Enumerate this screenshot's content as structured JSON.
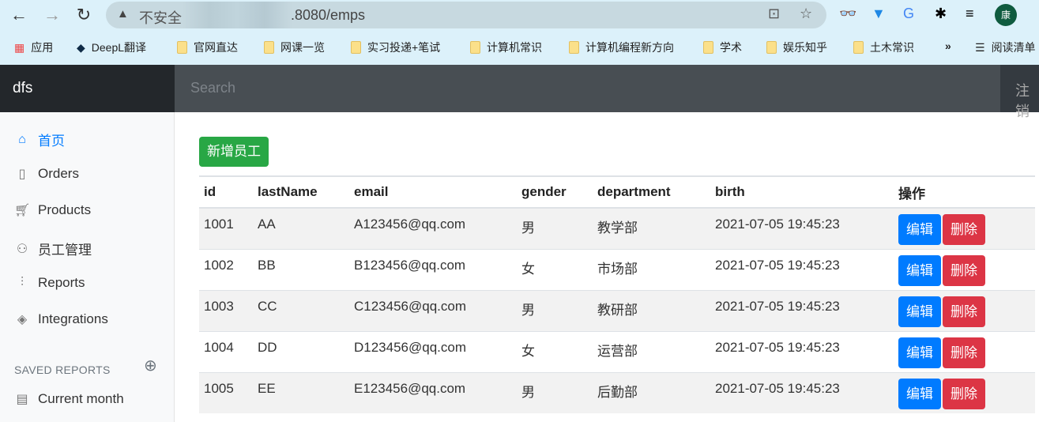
{
  "browser": {
    "security_label": "不安全",
    "url": ".8080/emps",
    "avatar_label": "康",
    "bookmarks": [
      {
        "label": "应用",
        "icon": "apps-icon"
      },
      {
        "label": "DeepL翻译",
        "icon": "deepl-icon"
      },
      {
        "label": "官网直达",
        "icon": "folder-icon"
      },
      {
        "label": "网课一览",
        "icon": "folder-icon"
      },
      {
        "label": "实习投递+笔试",
        "icon": "folder-icon"
      },
      {
        "label": "计算机常识",
        "icon": "folder-icon"
      },
      {
        "label": "计算机编程新方向",
        "icon": "folder-icon"
      },
      {
        "label": "学术",
        "icon": "folder-icon"
      },
      {
        "label": "娱乐知乎",
        "icon": "folder-icon"
      },
      {
        "label": "土木常识",
        "icon": "folder-icon"
      }
    ],
    "more": "»",
    "reading_list": "阅读清单"
  },
  "navbar": {
    "brand": "dfs",
    "search_placeholder": "Search",
    "signout": "注销"
  },
  "sidebar": {
    "items": [
      {
        "label": "首页",
        "icon": "home-icon",
        "active": true
      },
      {
        "label": "Orders",
        "icon": "file-icon"
      },
      {
        "label": "Products",
        "icon": "cart-icon"
      },
      {
        "label": "员工管理",
        "icon": "users-icon"
      },
      {
        "label": "Reports",
        "icon": "bar-chart-icon"
      },
      {
        "label": "Integrations",
        "icon": "layers-icon"
      }
    ],
    "saved_reports_heading": "SAVED REPORTS",
    "saved_items": [
      {
        "label": "Current month",
        "icon": "file-text-icon"
      }
    ]
  },
  "main": {
    "add_button": "新增员工",
    "columns": [
      "id",
      "lastName",
      "email",
      "gender",
      "department",
      "birth",
      "操作"
    ],
    "rows": [
      [
        "1001",
        "AA",
        "A123456@qq.com",
        "男",
        "教学部",
        "2021-07-05 19:45:23"
      ],
      [
        "1002",
        "BB",
        "B123456@qq.com",
        "女",
        "市场部",
        "2021-07-05 19:45:23"
      ],
      [
        "1003",
        "CC",
        "C123456@qq.com",
        "男",
        "教研部",
        "2021-07-05 19:45:23"
      ],
      [
        "1004",
        "DD",
        "D123456@qq.com",
        "女",
        "运营部",
        "2021-07-05 19:45:23"
      ],
      [
        "1005",
        "EE",
        "E123456@qq.com",
        "男",
        "后勤部",
        "2021-07-05 19:45:23"
      ]
    ],
    "edit_label": "编辑",
    "delete_label": "删除"
  }
}
